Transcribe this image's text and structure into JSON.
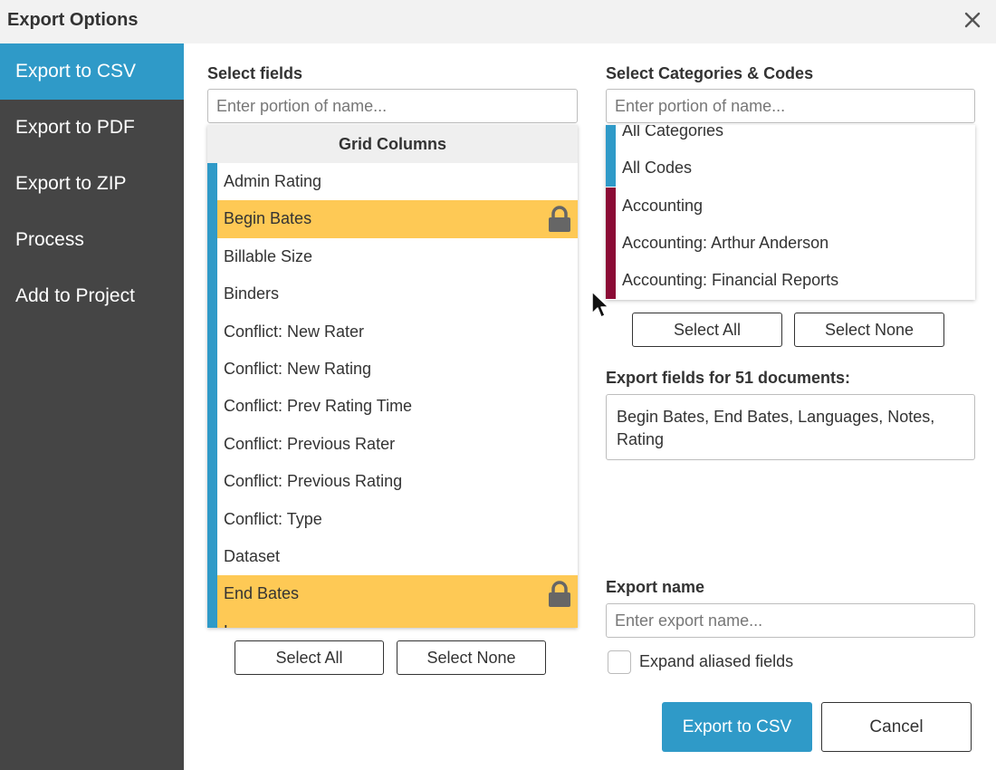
{
  "window": {
    "title": "Export Options"
  },
  "sidebar": {
    "items": [
      {
        "label": "Export to CSV",
        "active": true
      },
      {
        "label": "Export to PDF",
        "active": false
      },
      {
        "label": "Export to ZIP",
        "active": false
      },
      {
        "label": "Process",
        "active": false
      },
      {
        "label": "Add to Project",
        "active": false
      }
    ]
  },
  "fields": {
    "label": "Select fields",
    "search_placeholder": "Enter portion of name...",
    "list_header": "Grid Columns",
    "rows": [
      {
        "label": "Admin Rating",
        "locked": false
      },
      {
        "label": "Begin Bates",
        "locked": true
      },
      {
        "label": "Billable Size",
        "locked": false
      },
      {
        "label": "Binders",
        "locked": false
      },
      {
        "label": "Conflict: New Rater",
        "locked": false
      },
      {
        "label": "Conflict: New Rating",
        "locked": false
      },
      {
        "label": "Conflict: Prev Rating Time",
        "locked": false
      },
      {
        "label": "Conflict: Previous Rater",
        "locked": false
      },
      {
        "label": "Conflict: Previous Rating",
        "locked": false
      },
      {
        "label": "Conflict: Type",
        "locked": false
      },
      {
        "label": "Dataset",
        "locked": false
      },
      {
        "label": "End Bates",
        "locked": true
      },
      {
        "label": "L",
        "locked": true
      }
    ],
    "select_all": "Select All",
    "select_none": "Select None"
  },
  "categories": {
    "label": "Select Categories & Codes",
    "search_placeholder": "Enter portion of name...",
    "rows": [
      {
        "label": "All Categories",
        "color": "#2f9ac8"
      },
      {
        "label": "All Codes",
        "color": "#2f9ac8"
      },
      {
        "label": "Accounting",
        "color": "#8b0a35"
      },
      {
        "label": "Accounting: Arthur Anderson",
        "color": "#8b0a35"
      },
      {
        "label": "Accounting: Financial Reports",
        "color": "#8b0a35"
      }
    ],
    "select_all": "Select All",
    "select_none": "Select None"
  },
  "export_fields": {
    "label": "Export fields for 51 documents:",
    "value": "Begin Bates, End Bates, Languages, Notes, Rating"
  },
  "export_name": {
    "label": "Export name",
    "placeholder": "Enter export name..."
  },
  "expand_aliased": {
    "label": "Expand aliased fields",
    "checked": false
  },
  "actions": {
    "primary": "Export to CSV",
    "cancel": "Cancel"
  },
  "colors": {
    "accent": "#2f9ac8",
    "sidebar": "#454545",
    "locked_row": "#fec955",
    "category_red": "#8b0a35"
  }
}
